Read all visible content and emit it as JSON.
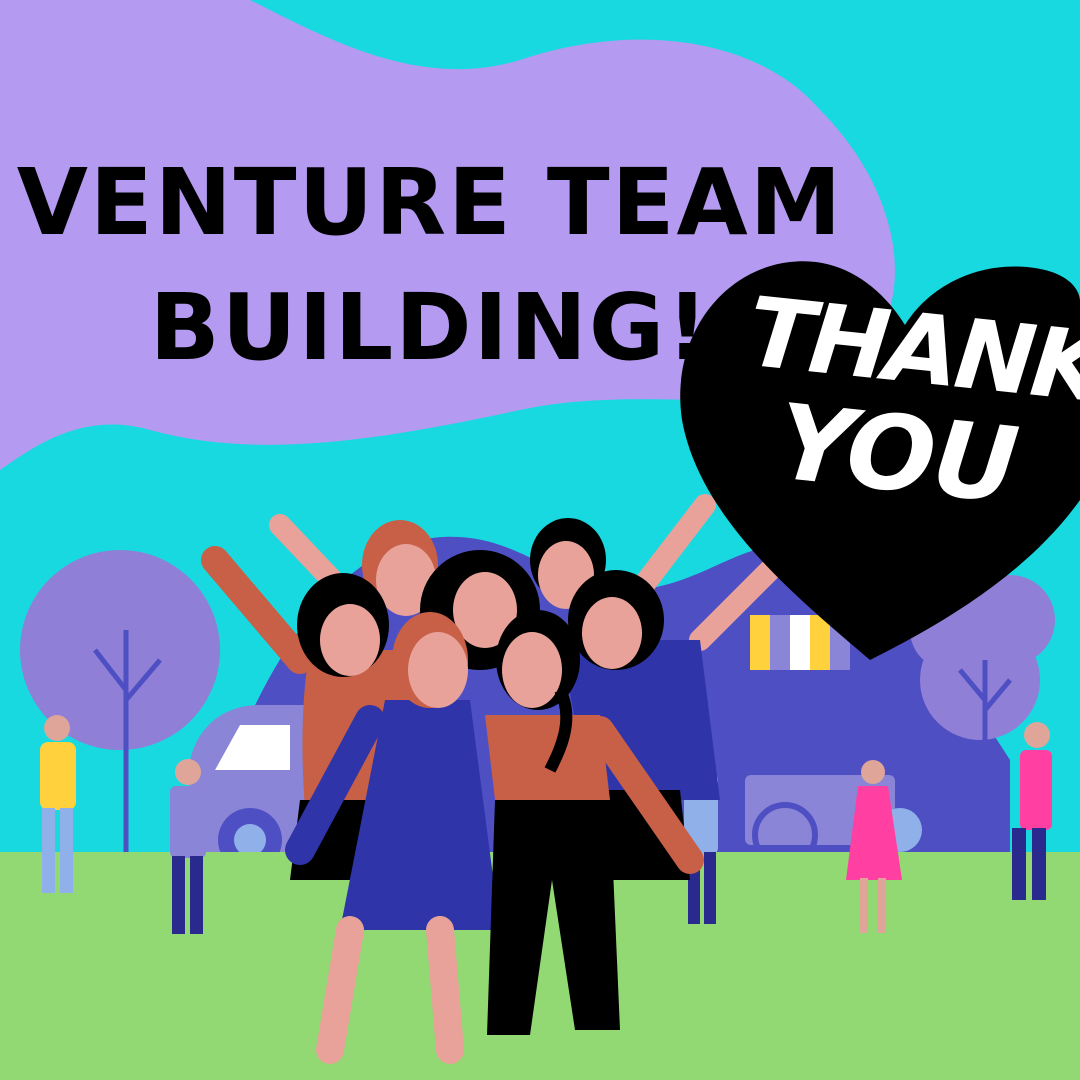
{
  "poster": {
    "headline_line1": "VENTURE TEAM",
    "headline_line2": "BUILDING!",
    "thank_line1": "THANK",
    "thank_line2": "YOU"
  },
  "colors": {
    "sky": "#19d9e0",
    "cloud": "#b49af0",
    "grass": "#92d873",
    "hill": "#4f4fc4",
    "tree": "#8f7fd6",
    "heart": "#000000",
    "text": "#000000",
    "thank_text": "#ffffff"
  },
  "icons": [
    "heart-shape",
    "tree-icon",
    "van-icon",
    "food-cart-icon",
    "person-figure"
  ]
}
